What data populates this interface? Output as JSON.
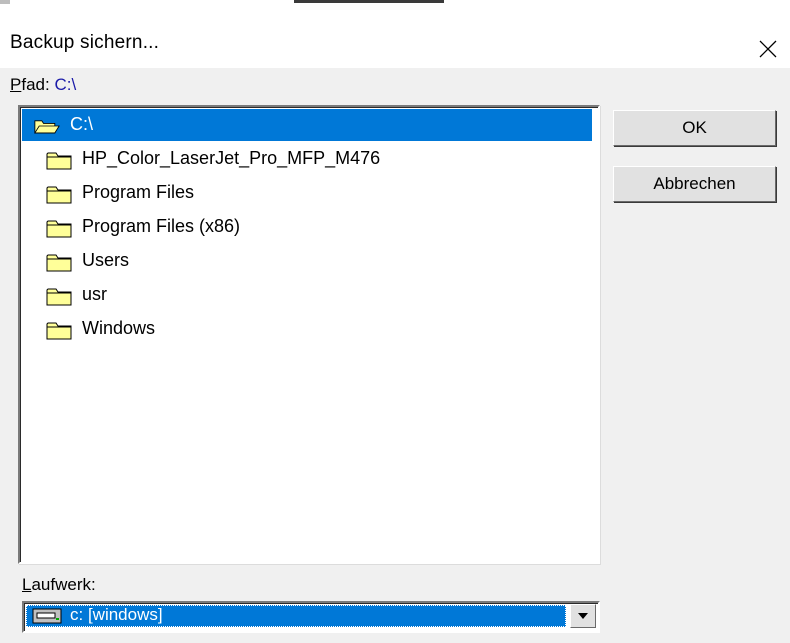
{
  "dialog": {
    "title": "Backup sichern...",
    "close_label": "✕"
  },
  "path": {
    "label_accel": "P",
    "label_rest": "fad:",
    "value": "C:\\"
  },
  "folders": [
    {
      "label": "C:\\",
      "icon": "open-folder-icon",
      "selected": true
    },
    {
      "label": "HP_Color_LaserJet_Pro_MFP_M476",
      "icon": "folder-icon",
      "selected": false
    },
    {
      "label": "Program Files",
      "icon": "folder-icon",
      "selected": false
    },
    {
      "label": "Program Files (x86)",
      "icon": "folder-icon",
      "selected": false
    },
    {
      "label": "Users",
      "icon": "folder-icon",
      "selected": false
    },
    {
      "label": "usr",
      "icon": "folder-icon",
      "selected": false
    },
    {
      "label": "Windows",
      "icon": "folder-icon",
      "selected": false
    }
  ],
  "buttons": {
    "ok": "OK",
    "cancel": "Abbrechen"
  },
  "drive": {
    "label_accel": "L",
    "label_rest": "aufwerk:",
    "value": "c: [windows]",
    "icon": "drive-icon"
  },
  "colors": {
    "selection": "#0078d7",
    "path_text": "#1a1aa8",
    "folder_fill": "#ffff99"
  }
}
